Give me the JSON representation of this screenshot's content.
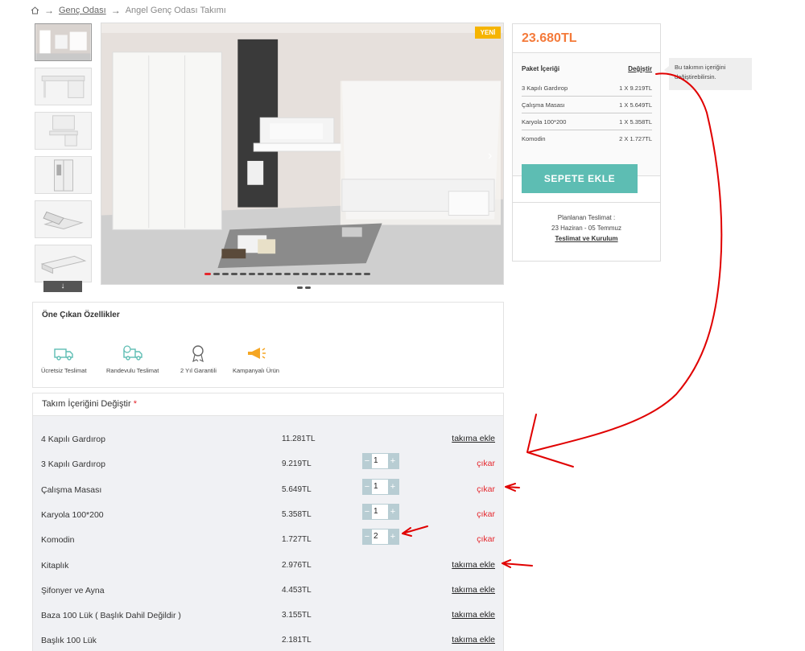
{
  "breadcrumb": {
    "home_icon": "home-icon",
    "items": [
      "Genç Odası",
      "Angel Genç Odası Takımı"
    ]
  },
  "gallery": {
    "badge": "YENİ",
    "thumbnail_count": 6,
    "dot_count": 19,
    "active_dot": 0,
    "next_icon": "chevron-right-icon",
    "thumbs_down_icon": "arrow-down-icon"
  },
  "price_panel": {
    "price": "23.680TL",
    "package_title": "Paket İçeriği",
    "change_label": "Değiştir",
    "items": [
      {
        "name": "3 Kapılı Gardırop",
        "qty": "1 X 9.219TL"
      },
      {
        "name": "Çalışma Masası",
        "qty": "1 X 5.649TL"
      },
      {
        "name": "Karyola 100*200",
        "qty": "1 X 5.358TL"
      },
      {
        "name": "Komodin",
        "qty": "2 X 1.727TL"
      }
    ],
    "cart_button": "SEPETE EKLE",
    "delivery_label": "Planlanan Teslimat :",
    "delivery_dates": "23 Haziran - 05 Temmuz",
    "delivery_link": "Teslimat ve Kurulum"
  },
  "tooltip": {
    "text": "Bu takımın içeriğini değiştirebilirsin."
  },
  "features": {
    "title": "Öne Çıkan Özellikler",
    "items": [
      {
        "label": "Ücretsiz Teslimat",
        "icon": "truck-icon"
      },
      {
        "label": "Randevulu Teslimat",
        "icon": "scheduled-truck-icon"
      },
      {
        "label": "2 Yıl Garantili",
        "icon": "award-badge-icon"
      },
      {
        "label": "Kampanyalı Ürün",
        "icon": "megaphone-icon"
      }
    ]
  },
  "change_contents": {
    "title": "Takım İçeriğini Değiştir",
    "required_mark": "*",
    "add_label": "takıma ekle",
    "remove_label": "çıkar",
    "rows": [
      {
        "name": "4 Kapılı Gardırop",
        "price": "11.281TL",
        "in_set": false,
        "qty": ""
      },
      {
        "name": "3 Kapılı Gardırop",
        "price": "9.219TL",
        "in_set": true,
        "qty": "1"
      },
      {
        "name": "Çalışma Masası",
        "price": "5.649TL",
        "in_set": true,
        "qty": "1"
      },
      {
        "name": "Karyola 100*200",
        "price": "5.358TL",
        "in_set": true,
        "qty": "1"
      },
      {
        "name": "Komodin",
        "price": "1.727TL",
        "in_set": true,
        "qty": "2"
      },
      {
        "name": "Kitaplık",
        "price": "2.976TL",
        "in_set": false,
        "qty": ""
      },
      {
        "name": "Şifonyer ve Ayna",
        "price": "4.453TL",
        "in_set": false,
        "qty": ""
      },
      {
        "name": "Baza 100 Lük ( Başlık Dahil Değildir )",
        "price": "3.155TL",
        "in_set": false,
        "qty": ""
      },
      {
        "name": "Başlık 100 Lük",
        "price": "2.181TL",
        "in_set": false,
        "qty": ""
      }
    ]
  },
  "colors": {
    "accent_price": "#f47a3a",
    "cart_button": "#5dbdb3",
    "remove_red": "#e5262c",
    "badge_yellow": "#f5b400",
    "annotation_red": "#e00000"
  }
}
